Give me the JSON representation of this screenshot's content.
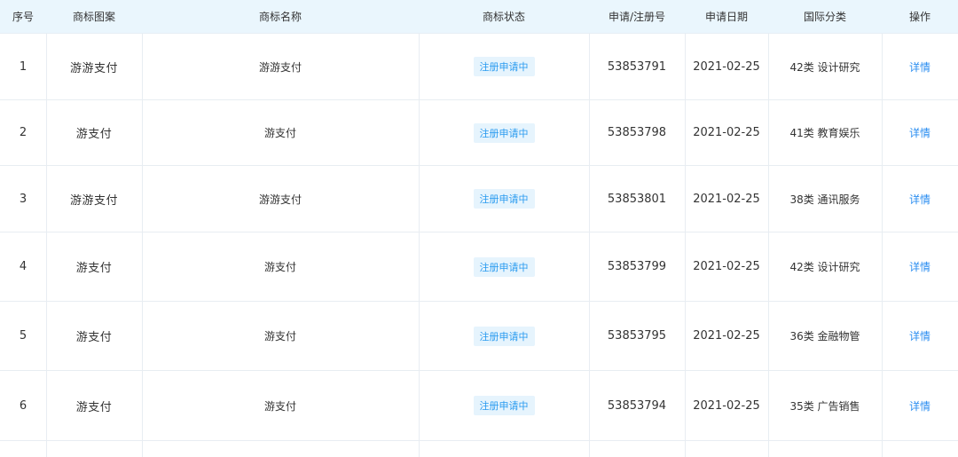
{
  "columns": {
    "index": "序号",
    "logo": "商标图案",
    "name": "商标名称",
    "status": "商标状态",
    "reg_no": "申请/注册号",
    "date": "申请日期",
    "class": "国际分类",
    "action": "操作"
  },
  "rows": [
    {
      "index": "1",
      "logo": "游游支付",
      "name": "游游支付",
      "status": "注册申请中",
      "reg_no": "53853791",
      "date": "2021-02-25",
      "class": "42类 设计研究",
      "action": "详情"
    },
    {
      "index": "2",
      "logo": "游支付",
      "name": "游支付",
      "status": "注册申请中",
      "reg_no": "53853798",
      "date": "2021-02-25",
      "class": "41类 教育娱乐",
      "action": "详情"
    },
    {
      "index": "3",
      "logo": "游游支付",
      "name": "游游支付",
      "status": "注册申请中",
      "reg_no": "53853801",
      "date": "2021-02-25",
      "class": "38类 通讯服务",
      "action": "详情"
    },
    {
      "index": "4",
      "logo": "游支付",
      "name": "游支付",
      "status": "注册申请中",
      "reg_no": "53853799",
      "date": "2021-02-25",
      "class": "42类 设计研究",
      "action": "详情"
    },
    {
      "index": "5",
      "logo": "游支付",
      "name": "游支付",
      "status": "注册申请中",
      "reg_no": "53853795",
      "date": "2021-02-25",
      "class": "36类 金融物管",
      "action": "详情"
    },
    {
      "index": "6",
      "logo": "游支付",
      "name": "游支付",
      "status": "注册申请中",
      "reg_no": "53853794",
      "date": "2021-02-25",
      "class": "35类 广告销售",
      "action": "详情"
    }
  ],
  "colors": {
    "header_bg": "#eaf6fd",
    "badge_bg": "#e6f4fd",
    "badge_text": "#2a9bf0",
    "link": "#2a8df0",
    "grid": "#e8edf2"
  }
}
